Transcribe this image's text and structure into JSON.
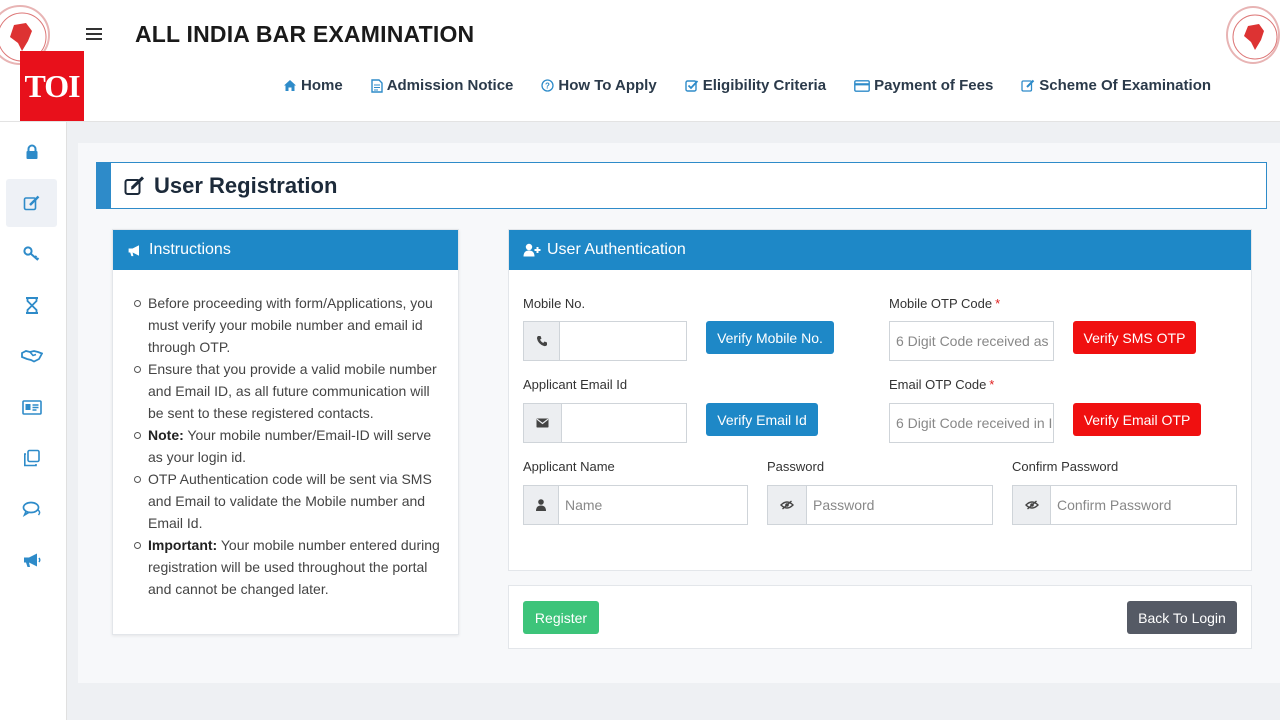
{
  "header": {
    "title": "ALL INDIA BAR EXAMINATION",
    "toi_badge": "TOI",
    "nav": [
      {
        "label": "Home",
        "icon": "home-icon"
      },
      {
        "label": "Admission Notice",
        "icon": "document-icon"
      },
      {
        "label": "How To Apply",
        "icon": "question-icon"
      },
      {
        "label": "Eligibility Criteria",
        "icon": "checkbox-icon"
      },
      {
        "label": "Payment of Fees",
        "icon": "card-icon"
      },
      {
        "label": "Scheme Of Examination",
        "icon": "edit-icon"
      }
    ]
  },
  "sidebar": {
    "icons": [
      "lock-icon",
      "edit-icon",
      "key-icon",
      "hourglass-icon",
      "handshake-icon",
      "id-card-icon",
      "copy-icon",
      "chat-icon",
      "megaphone-icon"
    ],
    "active_index": 1
  },
  "page": {
    "title": "User Registration"
  },
  "instructions": {
    "heading": "Instructions",
    "items": [
      {
        "bold": "",
        "text": "Before proceeding with form/Applications, you must verify your mobile number and email id through OTP."
      },
      {
        "bold": "",
        "text": "Ensure that you provide a valid mobile number and Email ID, as all future communication will be sent to these registered contacts."
      },
      {
        "bold": "Note:",
        "text": " Your mobile number/Email-ID will serve as your login id."
      },
      {
        "bold": "",
        "text": "OTP Authentication code will be sent via SMS and Email to validate the Mobile number and Email Id."
      },
      {
        "bold": "Important:",
        "text": " Your mobile number entered during registration will be used throughout the portal and cannot be changed later."
      }
    ]
  },
  "auth": {
    "heading": "User Authentication",
    "mobile_label": "Mobile No.",
    "mobile_value": "",
    "verify_mobile": "Verify Mobile No.",
    "mobile_otp_label": "Mobile OTP Code",
    "mobile_otp_placeholder": "6 Digit Code received as",
    "verify_sms": "Verify SMS OTP",
    "email_label": "Applicant Email Id",
    "email_value": "",
    "verify_email": "Verify Email Id",
    "email_otp_label": "Email OTP Code",
    "email_otp_placeholder": "6 Digit Code received in I",
    "verify_email_otp": "Verify Email OTP",
    "required_mark": "*",
    "name_label": "Applicant Name",
    "name_placeholder": "Name",
    "password_label": "Password",
    "password_placeholder": "Password",
    "confirm_label": "Confirm Password",
    "confirm_placeholder": "Confirm Password"
  },
  "actions": {
    "register": "Register",
    "back": "Back To Login"
  },
  "colors": {
    "primary": "#1e88c7",
    "danger": "#f01010",
    "success": "#3dc47a",
    "secondary": "#555a65",
    "toi_red": "#e8101b"
  }
}
